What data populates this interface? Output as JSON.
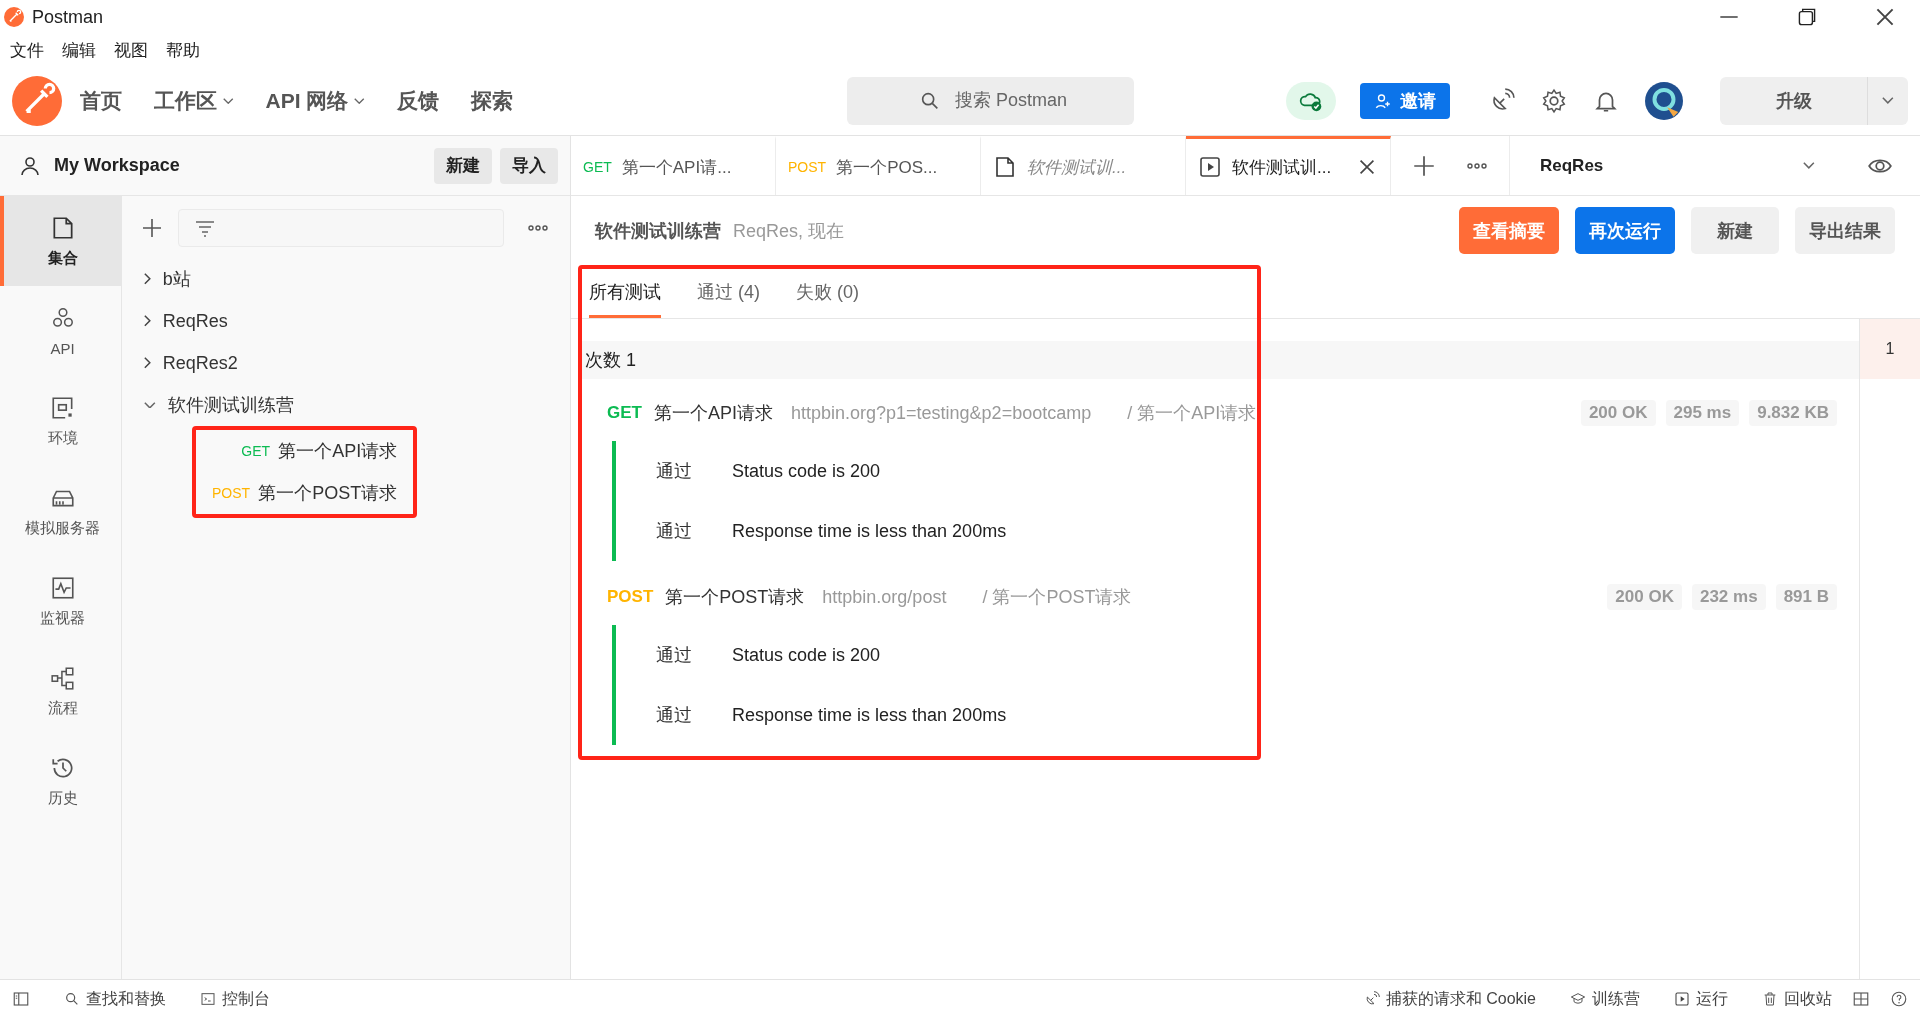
{
  "window": {
    "title": "Postman"
  },
  "menu": [
    "文件",
    "编辑",
    "视图",
    "帮助"
  ],
  "header": {
    "nav": [
      {
        "label": "首页",
        "dropdown": false
      },
      {
        "label": "工作区",
        "dropdown": true
      },
      {
        "label": "API 网络",
        "dropdown": true
      },
      {
        "label": "反馈",
        "dropdown": false
      },
      {
        "label": "探索",
        "dropdown": false
      }
    ],
    "search": {
      "placeholder": "搜索 Postman"
    },
    "invite_button": "邀请",
    "upgrade_button": "升级"
  },
  "workspace": {
    "name": "My Workspace",
    "buttons": [
      "新建",
      "导入"
    ]
  },
  "nav_rail": [
    {
      "label": "集合",
      "selected": true
    },
    {
      "label": "API",
      "selected": false
    },
    {
      "label": "环境",
      "selected": false
    },
    {
      "label": "模拟服务器",
      "selected": false
    },
    {
      "label": "监视器",
      "selected": false
    },
    {
      "label": "流程",
      "selected": false
    },
    {
      "label": "历史",
      "selected": false
    }
  ],
  "collections": [
    {
      "name": "b站",
      "expanded": false
    },
    {
      "name": "ReqRes",
      "expanded": false
    },
    {
      "name": "ReqRes2",
      "expanded": false
    },
    {
      "name": "软件测试训练营",
      "expanded": true,
      "highlighted": true,
      "children": [
        {
          "method": "GET",
          "color": "#0cbb52",
          "name": "第一个API请求"
        },
        {
          "method": "POST",
          "color": "#ffb400",
          "name": "第一个POST请求"
        }
      ]
    }
  ],
  "tabs": [
    {
      "kind": "request",
      "method": "GET",
      "color": "#0cbb52",
      "label": "第一个API请...",
      "selected": false
    },
    {
      "kind": "request",
      "method": "POST",
      "color": "#ffb400",
      "label": "第一个POS...",
      "selected": false
    },
    {
      "kind": "collection",
      "label": "软件测试训...",
      "selected": false
    },
    {
      "kind": "runner",
      "label": "软件测试训...",
      "selected": true
    }
  ],
  "environment": "ReqRes",
  "run": {
    "title": "软件测试训练营",
    "subtitle": "ReqRes, 现在",
    "buttons": [
      {
        "label": "查看摘要",
        "kind": "accent"
      },
      {
        "label": "再次运行",
        "kind": "primary"
      },
      {
        "label": "新建",
        "kind": "plain"
      },
      {
        "label": "导出结果",
        "kind": "plain"
      }
    ],
    "highlighted": true,
    "result_tabs": [
      {
        "label": "所有测试",
        "selected": true
      },
      {
        "label": "通过 (4)",
        "selected": false
      },
      {
        "label": "失败 (0)",
        "selected": false
      }
    ],
    "iteration": "次数 1",
    "iterations": [
      {
        "label": "1",
        "selected": true
      }
    ],
    "requests": [
      {
        "method": "GET",
        "color": "#0cbb52",
        "name": "第一个API请求",
        "url": "httpbin.org?p1=testing&p2=bootcamp",
        "path": "/ 第一个API请求",
        "status": "200 OK",
        "time": "295 ms",
        "size": "9.832 KB",
        "tests": [
          {
            "result": "通过",
            "passed": true,
            "name": "Status code is 200"
          },
          {
            "result": "通过",
            "passed": true,
            "name": "Response time is less than 200ms"
          }
        ]
      },
      {
        "method": "POST",
        "color": "#ffb400",
        "name": "第一个POST请求",
        "url": "httpbin.org/post",
        "path": "/ 第一个POST请求",
        "status": "200 OK",
        "time": "232 ms",
        "size": "891 B",
        "tests": [
          {
            "result": "通过",
            "passed": true,
            "name": "Status code is 200"
          },
          {
            "result": "通过",
            "passed": true,
            "name": "Response time is less than 200ms"
          }
        ]
      }
    ]
  },
  "status_bar": {
    "left": [
      "查找和替换",
      "控制台"
    ],
    "right": [
      "捕获的请求和 Cookie",
      "训练营",
      "运行",
      "回收站"
    ]
  }
}
